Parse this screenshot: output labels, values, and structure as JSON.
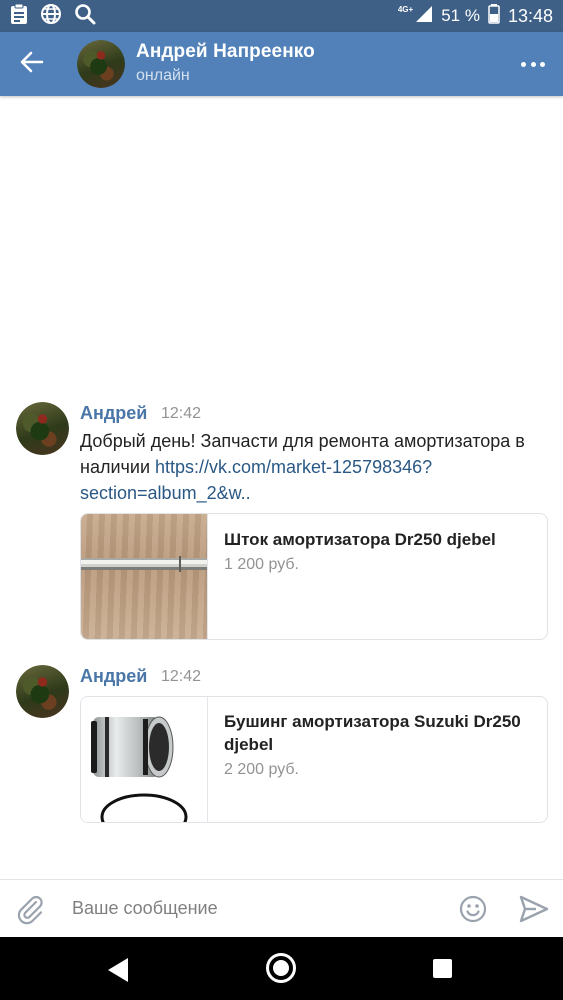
{
  "status_bar": {
    "network": "4G+",
    "battery": "51 %",
    "time": "13:48",
    "icons": [
      "clipboard-icon",
      "globe-icon",
      "search-icon",
      "signal-icon",
      "battery-icon"
    ]
  },
  "header": {
    "name": "Андрей Напреенко",
    "status": "онлайн",
    "icons": [
      "back-arrow-icon",
      "more-icon"
    ]
  },
  "messages": [
    {
      "author": "Андрей",
      "time": "12:42",
      "text": "Добрый день! Запчасти для ремонта амортизатора в наличии ",
      "link": "https://vk.com/market-125798346?section=album_2&w..",
      "product": {
        "title": "Шток амортизатора Dr250 djebel",
        "price": "1 200 руб."
      }
    },
    {
      "author": "Андрей",
      "time": "12:42",
      "product": {
        "title": "Бушинг амортизатора Suzuki Dr250 djebel",
        "price": "2 200 руб."
      }
    }
  ],
  "composer": {
    "placeholder": "Ваше сообщение",
    "icons": [
      "paperclip-icon",
      "emoji-icon",
      "send-icon"
    ]
  },
  "nav_bar": {
    "icons": [
      "nav-back-icon",
      "nav-home-icon",
      "nav-recents-icon"
    ]
  },
  "colors": {
    "status_bar": "#3e5f86",
    "header": "#5181b8",
    "author": "#4a76a8",
    "link": "#2a5885"
  }
}
